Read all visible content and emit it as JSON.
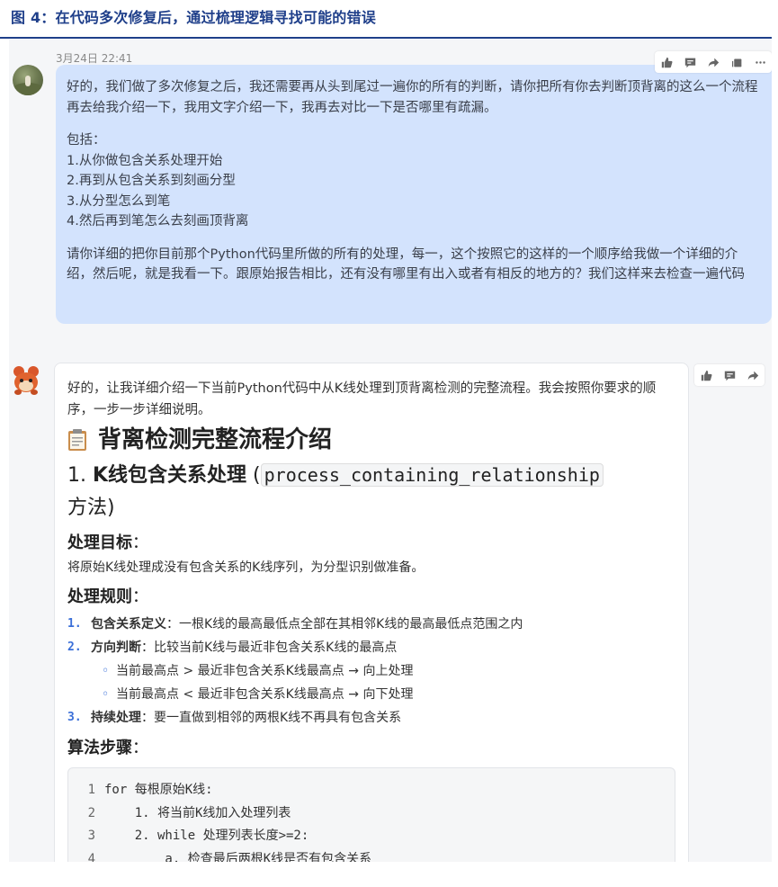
{
  "figure": {
    "title": "图 4：在代码多次修复后，通过梳理逻辑寻找可能的错误"
  },
  "user_message": {
    "timestamp": "3月24日 22:41",
    "lines": [
      "好的，我们做了多次修复之后，我还需要再从头到尾过一遍你的所有的判断，请你把所有你去判断顶背离的这么一个流程再去给我介绍一下，我用文字介绍一下，我再去对比一下是否哪里有疏漏。",
      "包括：",
      "1.从你做包含关系处理开始",
      "2.再到从包含关系到刻画分型",
      "3.从分型怎么到笔",
      "4.然后再到笔怎么去刻画顶背离",
      "请你详细的把你目前那个Python代码里所做的所有的处理，每一，这个按照它的这样的一个顺序给我做一个详细的介绍，然后呢，就是我看一下。跟原始报告相比，还有没有哪里有出入或者有相反的地方的？我们这样来去检查一遍代码"
    ],
    "tools": [
      "thumbs-up-icon",
      "comment-icon",
      "share-icon",
      "copy-icon",
      "more-icon"
    ]
  },
  "bot_message": {
    "intro": "好的，让我详细介绍一下当前Python代码中从K线处理到顶背离检测的完整流程。我会按照你要求的顺序，一步一步详细说明。",
    "heading": "背离检测完整流程介绍",
    "section1": {
      "prefix": "1. ",
      "title": "K线包含关系处理",
      "paren_open": "(",
      "code": "process_containing_relationship",
      "suffix": "方法)"
    },
    "goal_title": "处理目标",
    "goal_colon": "：",
    "goal_text": "将原始K线处理成没有包含关系的K线序列，为分型识别做准备。",
    "rules_title": "处理规则",
    "rules_colon": "：",
    "rules": [
      {
        "num": "1.",
        "term": "包含关系定义",
        "text": "：一根K线的最高最低点全部在其相邻K线的最高最低点范围之内"
      },
      {
        "num": "2.",
        "term": "方向判断",
        "text": "：比较当前K线与最近非包含关系K线的最高点"
      },
      {
        "num": "3.",
        "term": "持续处理",
        "text": "：要一直做到相邻的两根K线不再具有包含关系"
      }
    ],
    "subrules": [
      "当前最高点 > 最近非包含关系K线最高点 → 向上处理",
      "当前最高点 < 最近非包含关系K线最高点 → 向下处理"
    ],
    "steps_title": "算法步骤",
    "steps_colon": "：",
    "code_lines": [
      {
        "n": "1",
        "text": "for 每根原始K线:"
      },
      {
        "n": "2",
        "text": "    1. 将当前K线加入处理列表"
      },
      {
        "n": "3",
        "text": "    2. while 处理列表长度>=2:"
      },
      {
        "n": "4",
        "text": "        a. 检查最后两根K线是否有包含关系"
      }
    ],
    "tools": [
      "thumbs-up-icon",
      "comment-icon",
      "share-icon"
    ]
  }
}
